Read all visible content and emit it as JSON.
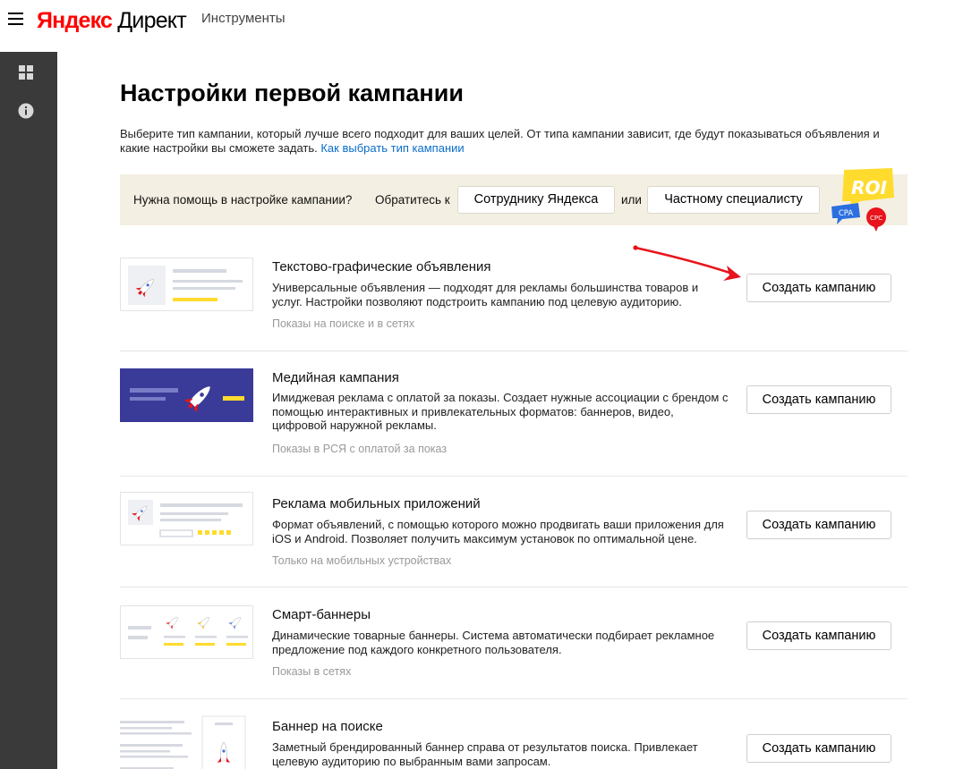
{
  "header": {
    "logo_brand": "Яндекс",
    "logo_product": "Директ",
    "tools_label": "Инструменты"
  },
  "sidebar": {
    "items": [
      {
        "icon": "grid-icon"
      },
      {
        "icon": "info-icon"
      }
    ]
  },
  "page": {
    "title": "Настройки первой кампании",
    "intro_text": "Выберите тип кампании, который лучше всего подходит для ваших целей. От типа кампании зависит, где будут показываться объявления и какие настройки вы сможете задать.",
    "intro_link": "Как выбрать тип кампании"
  },
  "help": {
    "question": "Нужна помощь в настройке кампании?",
    "contact_prefix": "Обратитесь к",
    "yandex_button": "Сотруднику Яндекса",
    "or_label": "или",
    "specialist_button": "Частному специалисту",
    "badge_roi": "ROI",
    "badge_cpa": "CPA",
    "badge_cpc": "CPC"
  },
  "campaigns": [
    {
      "title": "Текстово-графические объявления",
      "description": "Универсальные объявления — подходят для рекламы большинства товаров и услуг. Настройки позволяют подстроить кампанию под целевую аудиторию.",
      "note": "Показы на поиске и в сетях",
      "button": "Создать кампанию"
    },
    {
      "title": "Медийная кампания",
      "description": "Имиджевая реклама с оплатой за показы. Создает нужные ассоциации с брендом с помощью интерактивных и привлекательных форматов: баннеров, видео, цифровой наружной рекламы.",
      "note": "Показы в РСЯ с оплатой за показ",
      "button": "Создать кампанию"
    },
    {
      "title": "Реклама мобильных приложений",
      "description": "Формат объявлений, с помощью которого можно продвигать ваши приложения для iOS и Android. Позволяет получить максимум установок по оптимальной цене.",
      "note": "Только на мобильных устройствах",
      "button": "Создать кампанию"
    },
    {
      "title": "Смарт-баннеры",
      "description": "Динамические товарные баннеры. Система автоматически подбирает рекламное предложение под каждого конкретного пользователя.",
      "note": "Показы в сетях",
      "button": "Создать кампанию"
    },
    {
      "title": "Баннер на поиске",
      "description": "Заметный брендированный баннер справа от результатов поиска. Привлекает целевую аудиторию по выбранным вами запросам.",
      "note": "",
      "button": "Создать кампанию"
    }
  ],
  "colors": {
    "brand_red": "#ff0000",
    "link_blue": "#0a6ec9",
    "sidebar_bg": "#3a3a3a",
    "help_bg": "#f4efe3",
    "media_thumb_bg": "#3a3b98",
    "accent_yellow": "#ffdb2e",
    "arrow_red": "#e8131b"
  }
}
